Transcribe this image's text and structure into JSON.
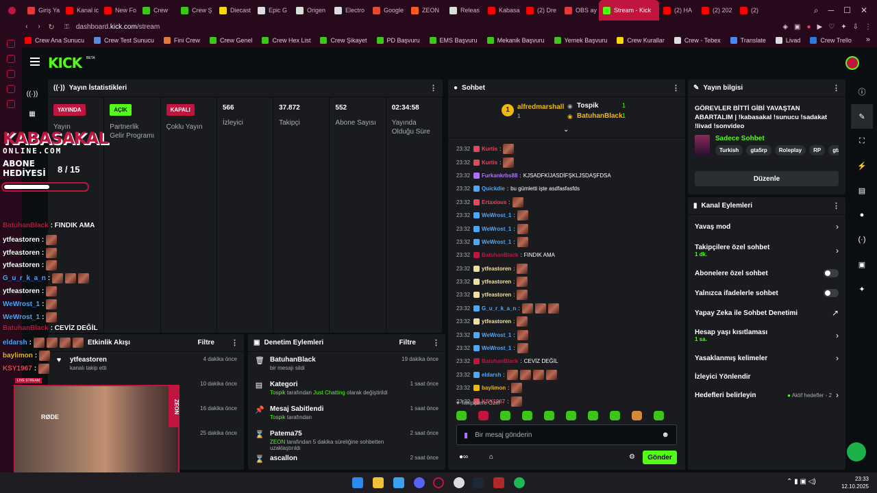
{
  "browser": {
    "tabs": [
      {
        "label": "Giriş Ya",
        "color": "#e03a3a"
      },
      {
        "label": "Kanal ic",
        "color": "#ff0000"
      },
      {
        "label": "New Fo",
        "color": "#ff0000"
      },
      {
        "label": "Crew",
        "color": "#3ec51a"
      },
      {
        "label": "Crew Ş",
        "color": "#3ec51a"
      },
      {
        "label": "Diecast",
        "color": "#f5d90a"
      },
      {
        "label": "Epic G",
        "color": "#dddddd"
      },
      {
        "label": "Origen",
        "color": "#dddddd"
      },
      {
        "label": "Electro",
        "color": "#dddddd"
      },
      {
        "label": "Google",
        "color": "#e04a3a"
      },
      {
        "label": "ZEON",
        "color": "#ff5a1e"
      },
      {
        "label": "Releas",
        "color": "#dddddd"
      },
      {
        "label": "Kabasa",
        "color": "#ff0000"
      },
      {
        "label": "(2) Dre",
        "color": "#ff0000"
      },
      {
        "label": "OBS ay",
        "color": "#e03a3a"
      },
      {
        "label": "Stream - Kick",
        "color": "#53fc18",
        "active": true
      },
      {
        "label": "(2) HA",
        "color": "#ff0000"
      },
      {
        "label": "(2) 202",
        "color": "#ff0000"
      },
      {
        "label": "(2)",
        "color": "#ff0000"
      }
    ],
    "url_prefix": "dashboard.",
    "url_domain": "kick.com",
    "url_path": "/stream",
    "bookmarks": [
      {
        "label": "Crew Ana Sunucu",
        "color": "#ff0000"
      },
      {
        "label": "Crew Test Sunucu",
        "color": "#5a8ad8"
      },
      {
        "label": "Fini Crew",
        "color": "#e07a3a"
      },
      {
        "label": "Crew Genel",
        "color": "#3ec51a"
      },
      {
        "label": "Crew Hex List",
        "color": "#3ec51a"
      },
      {
        "label": "Crew Şikayet",
        "color": "#3ec51a"
      },
      {
        "label": "PD Başvuru",
        "color": "#3ec51a"
      },
      {
        "label": "EMS Başvuru",
        "color": "#3ec51a"
      },
      {
        "label": "Mekanik Başvuru",
        "color": "#3ec51a"
      },
      {
        "label": "Yemek Başvuru",
        "color": "#3ec51a"
      },
      {
        "label": "Crew Kurallar",
        "color": "#f5d90a"
      },
      {
        "label": "Crew - Tebex",
        "color": "#dddddd"
      },
      {
        "label": "Translate",
        "color": "#4a8af0"
      },
      {
        "label": "Livad",
        "color": "#dddddd"
      },
      {
        "label": "Crew Trello",
        "color": "#2a7ae0"
      }
    ]
  },
  "kick": {
    "logo": "KICK",
    "beta": "BETA"
  },
  "stats": {
    "title": "Yayın İstatistikleri",
    "cols": [
      {
        "badge": "YAYINDA",
        "label": "Yayın"
      },
      {
        "badge": "AÇIK",
        "label": "Partnerlik Gelir Programı"
      },
      {
        "badge": "KAPALI",
        "label": "Çoklu Yayın"
      },
      {
        "value": "566",
        "label": "İzleyici"
      },
      {
        "value": "37.872",
        "label": "Takipçi"
      },
      {
        "value": "552",
        "label": "Abone Sayısı"
      },
      {
        "value": "02:34:58",
        "label": "Yayında Olduğu Süre"
      }
    ]
  },
  "activity": {
    "title": "Etkinlik Akışı",
    "filter": "Filtre",
    "items": [
      {
        "user": "ytfeastoren",
        "text": "kanalı takip etti",
        "time": "4 dakika önce"
      },
      {
        "time": "10 dakika önce"
      },
      {
        "time": "16 dakika önce"
      },
      {
        "text": "abonelik süresi - 5 ay!",
        "time": "25 dakika önce"
      }
    ]
  },
  "mod_actions": {
    "title": "Denetim Eylemleri",
    "filter": "Filtre",
    "items": [
      {
        "title": "BatuhanBlack",
        "sub": "bir mesajı sildi",
        "time": "19 dakika önce",
        "icon": "trash-icon"
      },
      {
        "title": "Kategori",
        "sub_user": "Tospik",
        "sub_mid": " tarafından ",
        "sub_green": "Just Chatting",
        "sub_end": " olarak değiştirildi",
        "time": "1 saat önce",
        "icon": "category-icon"
      },
      {
        "title": "Mesaj Sabitlendi",
        "sub_user": "Tospik",
        "sub_end": " tarafından",
        "time": "1 saat önce",
        "icon": "pin-icon"
      },
      {
        "title": "Patema75",
        "sub_user": "ZEON",
        "sub_end": " tarafından 5 dakika süreliğine sohbetten uzaklaştırıldı",
        "time": "2 saat önce",
        "icon": "hourglass-icon"
      },
      {
        "title": "ascallon",
        "time": "2 saat önce",
        "icon": "hourglass-icon"
      }
    ]
  },
  "chat": {
    "title": "Sohbet",
    "pinned": {
      "user1": "alfredmarshall",
      "count1": "1",
      "user2": "Tospik",
      "count2": "1",
      "user3": "BatuhanBlack",
      "count3": "1"
    },
    "messages": [
      {
        "time": "23:32",
        "user": "Kurtis",
        "color": "#e04a5a",
        "text": "",
        "emotes": 1
      },
      {
        "time": "23:32",
        "user": "Kurtis",
        "color": "#e04a5a",
        "text": "",
        "emotes": 1
      },
      {
        "time": "23:32",
        "user": "Furkankrbs88",
        "color": "#b070ff",
        "text": "KJSADFKİJASDİFŞKLJSDAŞFDSA",
        "emotes": 0
      },
      {
        "time": "23:32",
        "user": "Quickdie",
        "color": "#4aa8ff",
        "text": "bu gümletti işte asdfasfasfds",
        "emotes": 0
      },
      {
        "time": "23:32",
        "user": "Ertaxious",
        "color": "#e04a5a",
        "text": "",
        "emotes": 1
      },
      {
        "time": "23:32",
        "user": "WeWrost_1",
        "color": "#4aa8ff",
        "text": "",
        "emotes": 1
      },
      {
        "time": "23:32",
        "user": "WeWrost_1",
        "color": "#4aa8ff",
        "text": "",
        "emotes": 1
      },
      {
        "time": "23:32",
        "user": "WeWrost_1",
        "color": "#4aa8ff",
        "text": "",
        "emotes": 1
      },
      {
        "time": "23:32",
        "user": "BatuhanBlack",
        "color": "#c0153f",
        "text": "FINDIK AMA",
        "emotes": 0
      },
      {
        "time": "23:32",
        "user": "ytfeastoren",
        "color": "#f0e0a0",
        "text": "",
        "emotes": 1
      },
      {
        "time": "23:32",
        "user": "ytfeastoren",
        "color": "#f0e0a0",
        "text": "",
        "emotes": 1
      },
      {
        "time": "23:32",
        "user": "ytfeastoren",
        "color": "#f0e0a0",
        "text": "",
        "emotes": 1
      },
      {
        "time": "23:32",
        "user": "G_u_r_k_a_n",
        "color": "#4aa8ff",
        "text": "",
        "emotes": 3
      },
      {
        "time": "23:32",
        "user": "ytfeastoren",
        "color": "#f0e0a0",
        "text": "",
        "emotes": 1
      },
      {
        "time": "23:32",
        "user": "WeWrost_1",
        "color": "#4aa8ff",
        "text": "",
        "emotes": 1
      },
      {
        "time": "23:32",
        "user": "WeWrost_1",
        "color": "#4aa8ff",
        "text": "",
        "emotes": 1
      },
      {
        "time": "23:32",
        "user": "BatuhanBlack",
        "color": "#c0153f",
        "text": "CEVİZ DEĞİL",
        "emotes": 0
      },
      {
        "time": "23:32",
        "user": "eldarsh",
        "color": "#4aa8ff",
        "text": "",
        "emotes": 4
      },
      {
        "time": "23:32",
        "user": "baylimon",
        "color": "#f0b70e",
        "text": "",
        "emotes": 1
      },
      {
        "time": "23:32",
        "user": "KSY1967",
        "color": "#e04a5a",
        "text": "",
        "emotes": 1
      }
    ],
    "followers_only": "Takipçilere Özel",
    "input_placeholder": "Bir mesaj gönderin",
    "send": "Gönder"
  },
  "stream_info": {
    "header": "Yayın bilgisi",
    "title": "GÖREVLER BİTTİ GİBİ YAVAŞTAN ABARTALIM | !kabasakal !sunucu !sadakat !livad !sonvideo",
    "category": "Sadece Sohbet",
    "tags": [
      "Turkish",
      "gta5rp",
      "Roleplay",
      "RP",
      "gta5"
    ],
    "edit": "Düzenle"
  },
  "channel_actions": {
    "title": "Kanal Eylemleri",
    "items": [
      {
        "label": "Yavaş mod",
        "kind": "chev"
      },
      {
        "label": "Takipçilere özel sohbet",
        "sub": "1 dk.",
        "kind": "chev"
      },
      {
        "label": "Abonelere özel sohbet",
        "kind": "toggle"
      },
      {
        "label": "Yalnızca ifadelerle sohbet",
        "kind": "toggle"
      },
      {
        "label": "Yapay Zeka ile Sohbet Denetimi",
        "kind": "ext"
      },
      {
        "label": "Hesap yaşı kısıtlaması",
        "sub": "1 sa.",
        "kind": "chev"
      },
      {
        "label": "Yasaklanmış kelimeler",
        "kind": "chev"
      },
      {
        "label": "İzleyici Yönlendir",
        "kind": "none"
      },
      {
        "label": "Hedefleri belirleyin",
        "extra": "Aktif hedefler - 2",
        "kind": "chev"
      }
    ]
  },
  "overlay": {
    "brand": "KABASAKAL",
    "brand_sub": "ONLINE.COM",
    "goal_label_1": "ABONE",
    "goal_label_2": "HEDİYESİ",
    "goal_count": "8 / 15",
    "goal_progress": 0.53,
    "chat": [
      {
        "user": "BatuhanBlack",
        "color": "#c0153f",
        "text": ": FINDIK AMA",
        "emotes": 0
      },
      {
        "user": "ytfeastoren",
        "color": "#ffffff",
        "text": " :",
        "emotes": 1
      },
      {
        "user": "ytfeastoren",
        "color": "#ffffff",
        "text": " :",
        "emotes": 1
      },
      {
        "user": "ytfeastoren",
        "color": "#ffffff",
        "text": " :",
        "emotes": 1
      },
      {
        "user": "G_u_r_k_a_n",
        "color": "#4aa8ff",
        "text": " :",
        "emotes": 3
      },
      {
        "user": "ytfeastoren",
        "color": "#ffffff",
        "text": " :",
        "emotes": 1
      },
      {
        "user": "WeWrost_1",
        "color": "#4aa8ff",
        "text": " :",
        "emotes": 1
      },
      {
        "user": "WeWrost_1",
        "color": "#4aa8ff",
        "text": " :",
        "emotes": 1
      },
      {
        "user": "BatuhanBlack",
        "color": "#c0153f",
        "text": ": CEVİZ DEĞİL",
        "emotes": 0
      },
      {
        "user": "eldarsh",
        "color": "#4aa8ff",
        "text": " :",
        "emotes": 4
      },
      {
        "user": "baylimon",
        "color": "#f0b70e",
        "text": " :",
        "emotes": 1
      },
      {
        "user": "KSY1967",
        "color": "#e04a5a",
        "text": " :",
        "emotes": 1
      }
    ],
    "cam_label": "LIVE STREAM",
    "cam_brand": "ZEON",
    "cam_text": "RØDE"
  },
  "taskbar": {
    "time": "23:33",
    "date": "12.10.2025"
  },
  "colors": {
    "kick_green": "#53fc18",
    "accent_red": "#c0153f"
  }
}
